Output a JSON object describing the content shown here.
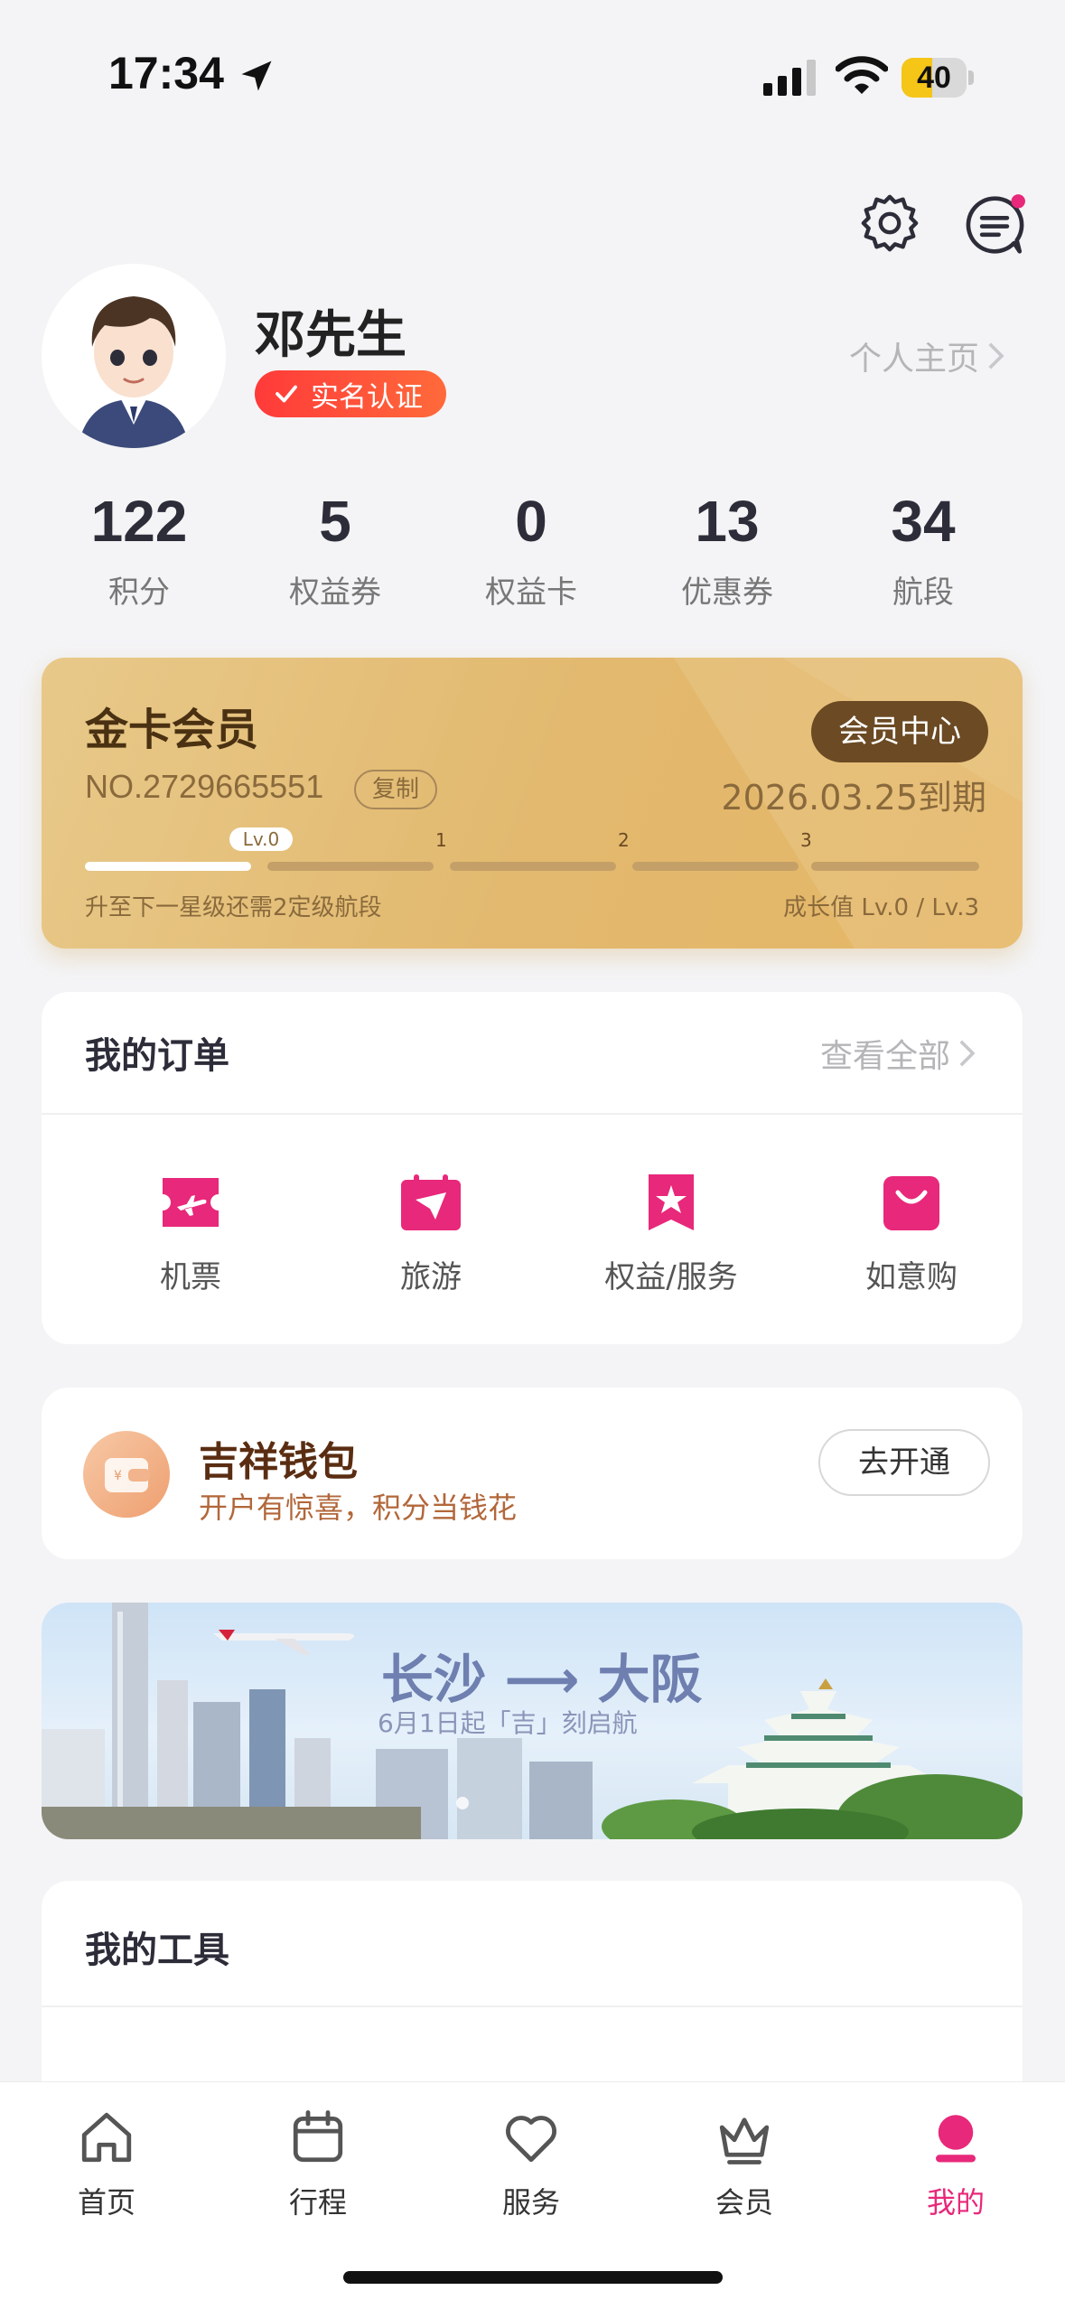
{
  "status_bar": {
    "time": "17:34",
    "battery": "40"
  },
  "profile": {
    "name": "邓先生",
    "verify_badge": "实名认证",
    "homepage_link": "个人主页"
  },
  "stats": [
    {
      "value": "122",
      "label": "积分"
    },
    {
      "value": "5",
      "label": "权益券"
    },
    {
      "value": "0",
      "label": "权益卡"
    },
    {
      "value": "13",
      "label": "优惠券"
    },
    {
      "value": "34",
      "label": "航段"
    }
  ],
  "member_card": {
    "title": "金卡会员",
    "center_button": "会员中心",
    "number": "NO.2729665551",
    "copy": "复制",
    "expiry": "2026.03.25到期",
    "level_tag": "Lv.0",
    "levels": [
      "1",
      "2",
      "3"
    ],
    "hint": "升至下一星级还需2定级航段",
    "growth": "成长值 Lv.0 / Lv.3",
    "progress_fraction": 0.22
  },
  "orders": {
    "title": "我的订单",
    "view_all": "查看全部",
    "items": [
      {
        "label": "机票",
        "icon": "plane-ticket-icon"
      },
      {
        "label": "旅游",
        "icon": "travel-calendar-icon"
      },
      {
        "label": "权益/服务",
        "icon": "star-bookmark-icon"
      },
      {
        "label": "如意购",
        "icon": "shopping-bag-icon"
      }
    ]
  },
  "wallet": {
    "title": "吉祥钱包",
    "subtitle": "开户有惊喜，积分当钱花",
    "button": "去开通"
  },
  "banner": {
    "title": "长沙 ⟶ 大阪",
    "subtitle": "6月1日起「吉」刻启航"
  },
  "tools": {
    "title": "我的工具"
  },
  "tabbar": [
    {
      "label": "首页",
      "icon": "home-icon"
    },
    {
      "label": "行程",
      "icon": "calendar-icon"
    },
    {
      "label": "服务",
      "icon": "heart-icon"
    },
    {
      "label": "会员",
      "icon": "crown-icon"
    },
    {
      "label": "我的",
      "icon": "profile-icon"
    }
  ],
  "colors": {
    "accent": "#e8287a",
    "gold": "#e2b96f",
    "verify": "#ff3a3a"
  }
}
